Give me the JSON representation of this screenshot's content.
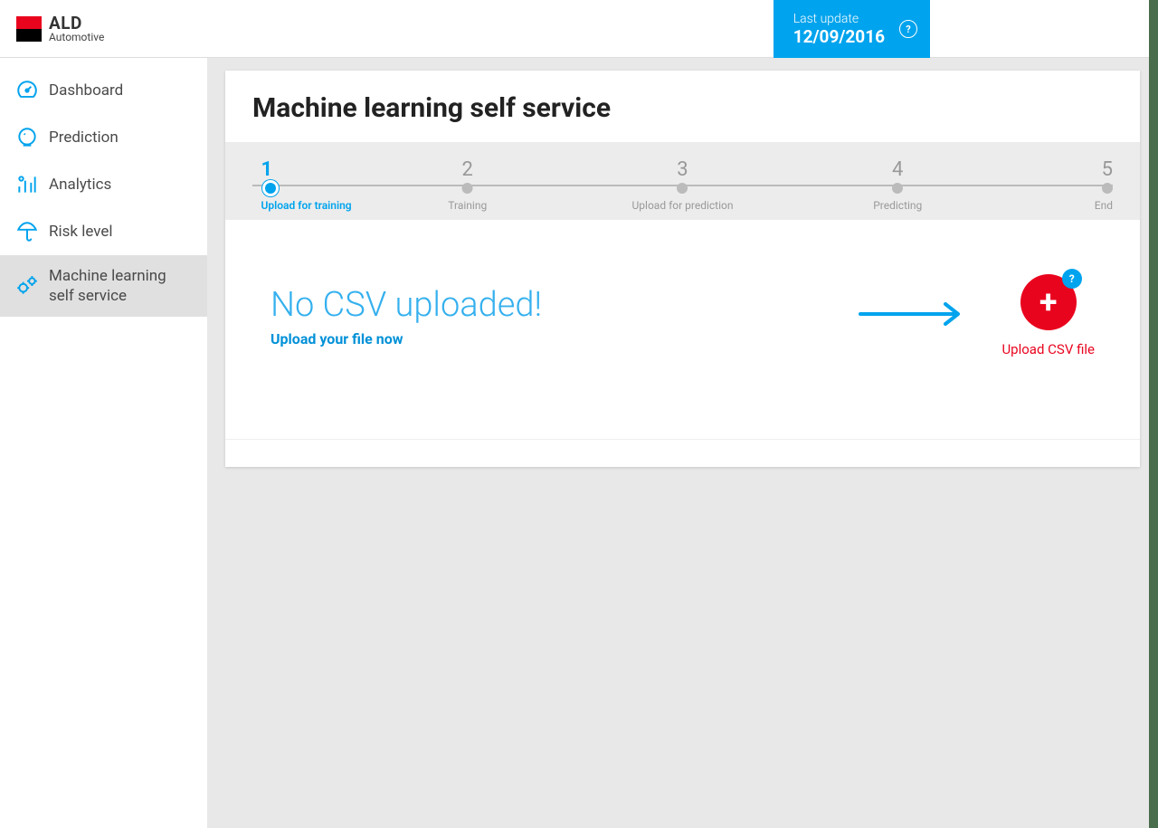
{
  "brand": {
    "name": "ALD",
    "sub": "Automotive"
  },
  "header": {
    "last_update_label": "Last update",
    "last_update_date": "12/09/2016",
    "help": "?"
  },
  "sidebar": {
    "items": [
      {
        "label": "Dashboard"
      },
      {
        "label": "Prediction"
      },
      {
        "label": "Analytics"
      },
      {
        "label": "Risk level"
      },
      {
        "label": "Machine learning self service"
      }
    ]
  },
  "page": {
    "title": "Machine learning self service",
    "steps": [
      {
        "num": "1",
        "label": "Upload for training"
      },
      {
        "num": "2",
        "label": "Training"
      },
      {
        "num": "3",
        "label": "Upload for prediction"
      },
      {
        "num": "4",
        "label": "Predicting"
      },
      {
        "num": "5",
        "label": "End"
      }
    ],
    "empty": {
      "title": "No CSV uploaded!",
      "sub": "Upload your file now"
    },
    "upload": {
      "label": "Upload CSV file",
      "help": "?"
    }
  }
}
